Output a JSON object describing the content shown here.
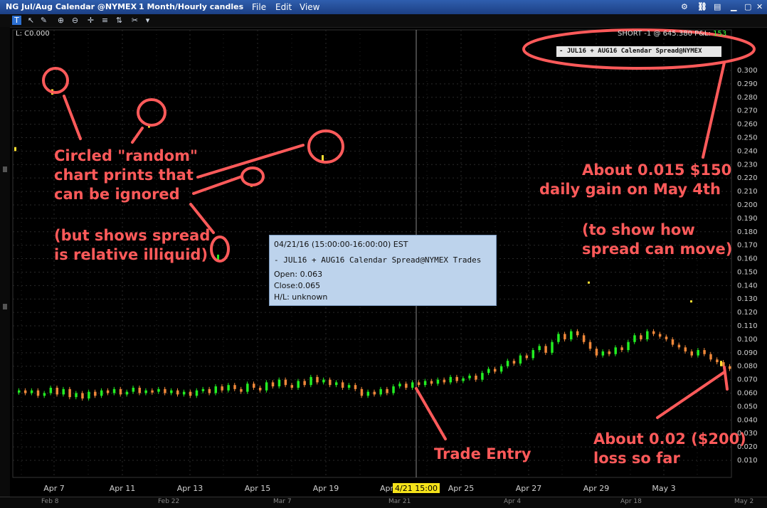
{
  "window": {
    "title": "NG Jul/Aug Calendar @NYMEX",
    "interval": "1 Month/Hourly candles",
    "menu": [
      "File",
      "Edit",
      "View"
    ]
  },
  "header": {
    "left_label": "L: C0.000",
    "position_text": "SHORT -1 @ 645.380 P&L:",
    "pnl_value": "153",
    "instrument_label": "- JUL16 + AUG16 Calendar Spread@NYMEX"
  },
  "tooltip": {
    "time": "04/21/16 (15:00:00-16:00:00) EST",
    "instrument": "- JUL16 + AUG16 Calendar Spread@NYMEX Trades",
    "open": "Open: 0.063",
    "close": "Close:0.065",
    "hl": "H/L:    unknown"
  },
  "annotations": {
    "circled": [
      "Circled \"random\"",
      "chart prints that",
      "can be ignored"
    ],
    "illiquid": [
      "(but shows spread",
      "is relative illiquid)"
    ],
    "gain": [
      "About 0.015 $150",
      "daily gain on May 4th"
    ],
    "move": [
      "(to show how",
      "spread can move)"
    ],
    "entry": "Trade Entry",
    "loss": [
      "About 0.02 ($200)",
      "loss so far"
    ]
  },
  "bottom_dates": [
    "Feb 8",
    "Feb 22",
    "Mar 7",
    "Mar 21",
    "Apr 4",
    "Apr 18",
    "May 2"
  ],
  "chart_data": {
    "type": "candlestick",
    "ylim": [
      0.0,
      0.31
    ],
    "y_ticks": [
      "0.300",
      "0.290",
      "0.280",
      "0.270",
      "0.260",
      "0.250",
      "0.240",
      "0.230",
      "0.220",
      "0.210",
      "0.200",
      "0.190",
      "0.180",
      "0.170",
      "0.160",
      "0.150",
      "0.140",
      "0.130",
      "0.120",
      "0.110",
      "0.100",
      "0.090",
      "0.080",
      "0.070",
      "0.060",
      "0.050",
      "0.040",
      "0.030",
      "0.020",
      "0.010"
    ],
    "x_ticks": [
      "Apr 7",
      "Apr 11",
      "Apr 13",
      "Apr 15",
      "Apr 19",
      "Apr 25",
      "Apr 27",
      "Apr 29",
      "May 3"
    ],
    "crosshair_label": "4/21 15:00",
    "crosshair_label_prefix": "Apr",
    "colors": {
      "up": "#22ee22",
      "down": "#f0883a",
      "print": "#ffe033",
      "annotation": "#ff5a5a"
    },
    "candles_open": [
      0.061,
      0.062,
      0.06,
      0.062,
      0.058,
      0.06,
      0.064,
      0.059,
      0.063,
      0.057,
      0.06,
      0.056,
      0.061,
      0.058,
      0.062,
      0.06,
      0.063,
      0.059,
      0.061,
      0.064,
      0.06,
      0.062,
      0.061,
      0.063,
      0.06,
      0.062,
      0.059,
      0.061,
      0.058,
      0.062,
      0.063,
      0.06,
      0.065,
      0.062,
      0.066,
      0.063,
      0.061,
      0.067,
      0.064,
      0.062,
      0.068,
      0.065,
      0.07,
      0.066,
      0.064,
      0.069,
      0.066,
      0.072,
      0.068,
      0.07,
      0.066,
      0.068,
      0.064,
      0.066,
      0.063,
      0.058,
      0.061,
      0.059,
      0.063,
      0.06,
      0.065,
      0.067,
      0.064,
      0.068,
      0.066,
      0.069,
      0.067,
      0.07,
      0.068,
      0.072,
      0.069,
      0.071,
      0.073,
      0.07,
      0.075,
      0.078,
      0.076,
      0.08,
      0.084,
      0.082,
      0.088,
      0.086,
      0.092,
      0.095,
      0.09,
      0.098,
      0.104,
      0.1,
      0.106,
      0.103,
      0.098,
      0.093,
      0.088,
      0.091,
      0.089,
      0.094,
      0.092,
      0.098,
      0.103,
      0.1,
      0.106,
      0.104,
      0.102,
      0.1,
      0.096,
      0.094,
      0.091,
      0.088,
      0.092,
      0.089,
      0.085,
      0.083,
      0.08
    ],
    "candles_close": [
      0.062,
      0.06,
      0.062,
      0.058,
      0.06,
      0.064,
      0.059,
      0.063,
      0.057,
      0.06,
      0.056,
      0.061,
      0.058,
      0.062,
      0.06,
      0.063,
      0.059,
      0.061,
      0.064,
      0.06,
      0.062,
      0.061,
      0.063,
      0.06,
      0.062,
      0.059,
      0.061,
      0.058,
      0.062,
      0.063,
      0.06,
      0.065,
      0.062,
      0.066,
      0.063,
      0.061,
      0.067,
      0.064,
      0.062,
      0.068,
      0.065,
      0.07,
      0.066,
      0.064,
      0.069,
      0.066,
      0.072,
      0.068,
      0.07,
      0.066,
      0.068,
      0.064,
      0.066,
      0.063,
      0.058,
      0.061,
      0.059,
      0.063,
      0.06,
      0.065,
      0.067,
      0.064,
      0.068,
      0.066,
      0.069,
      0.067,
      0.07,
      0.068,
      0.072,
      0.069,
      0.071,
      0.073,
      0.07,
      0.075,
      0.078,
      0.076,
      0.08,
      0.084,
      0.082,
      0.088,
      0.086,
      0.092,
      0.095,
      0.09,
      0.098,
      0.104,
      0.1,
      0.106,
      0.103,
      0.098,
      0.093,
      0.088,
      0.091,
      0.089,
      0.094,
      0.092,
      0.098,
      0.103,
      0.1,
      0.106,
      0.104,
      0.102,
      0.1,
      0.096,
      0.094,
      0.091,
      0.088,
      0.092,
      0.089,
      0.085,
      0.083,
      0.08,
      0.078
    ],
    "random_prints": [
      [
        0.286,
        0.282
      ],
      [
        0.259,
        0.258
      ],
      [
        0.237,
        0.232
      ],
      [
        0.215,
        0.214
      ],
      [
        0.163,
        0.159
      ],
      [
        0.243,
        0.24
      ],
      [
        0.143,
        0.142
      ],
      [
        0.129,
        0.128
      ],
      [
        0.084,
        0.08
      ]
    ]
  }
}
